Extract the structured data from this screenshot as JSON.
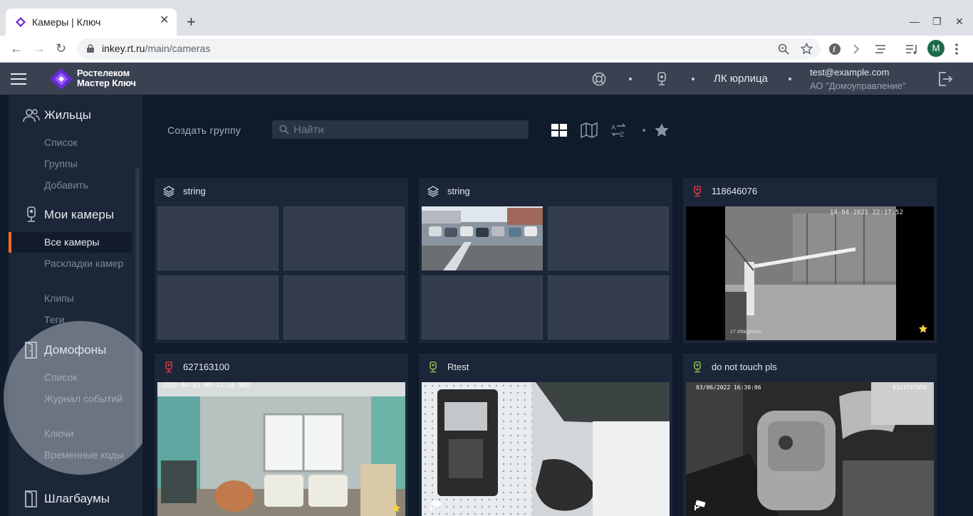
{
  "browser": {
    "tab_title": "Камеры | Ключ",
    "tab_close": "✕",
    "new_tab": "+",
    "url_host": "inkey.rt.ru",
    "url_path": "/main/cameras",
    "profile_initial": "M",
    "win_minimize": "—",
    "win_restore": "❐",
    "win_close": "✕",
    "back": "←",
    "forward": "→",
    "reload": "↻"
  },
  "header": {
    "logo_line1": "Ростелеком",
    "logo_line2": "Мастер Ключ",
    "account_type": "ЛК юрлица",
    "user_email": "test@example.com",
    "user_org": "АО \"Домоуправление\""
  },
  "sidebar": {
    "residents": {
      "label": "Жильцы",
      "items": [
        "Список",
        "Группы",
        "Добавить"
      ]
    },
    "cameras": {
      "label": "Мои камеры",
      "active": "Все камеры",
      "items": [
        "Раскладки камер",
        "Клипы",
        "Теги"
      ]
    },
    "intercoms": {
      "label": "Домофоны",
      "items": [
        "Список",
        "Журнал событий",
        "Ключи",
        "Временные коды"
      ]
    },
    "barriers": {
      "label": "Шлагбаумы"
    }
  },
  "toolbar": {
    "create_group": "Создать группу",
    "search_placeholder": "Найти"
  },
  "tiles": [
    {
      "name": "string",
      "kind": "group",
      "status_color": "#c9ced6"
    },
    {
      "name": "string",
      "kind": "group",
      "status_color": "#c9ced6"
    },
    {
      "name": "118646076",
      "kind": "camera",
      "status_color": "#e5393b",
      "feed_timestamp": "14-04-2021 22:17:52",
      "feed_caption": "17 shlagbaum",
      "favorite": true
    },
    {
      "name": "627163100",
      "kind": "camera",
      "status_color": "#e5393b",
      "feed_timestamp": "2020-04-01 09:22:16 WED",
      "favorite": true
    },
    {
      "name": "Rtest",
      "kind": "camera",
      "status_color": "#8bc34a"
    },
    {
      "name": "do not touch pls",
      "kind": "camera",
      "status_color": "#8bc34a",
      "feed_timestamp": "03/06/2022 16:30:06",
      "feed_code": "8321797956"
    }
  ],
  "colors": {
    "accent": "#ff6a2a",
    "favorite": "#f5d23b",
    "offline": "#e5393b",
    "online": "#8bc34a"
  }
}
